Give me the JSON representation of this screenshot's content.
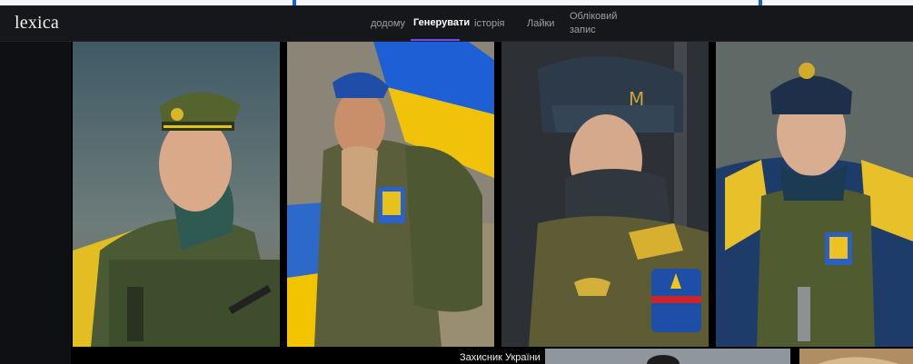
{
  "app": {
    "logo": "lexica"
  },
  "nav": {
    "home": "додому",
    "generate": "Генерувати",
    "history": "історія",
    "likes": "Лайки",
    "account_line1": "Обліковий",
    "account_line2": "запис"
  },
  "gallery": {
    "caption": "Захисник України"
  },
  "colors": {
    "accent": "#6d4cf0",
    "flag_blue": "#1f5fd6",
    "flag_yellow": "#f2c500",
    "uniform": "#556338"
  }
}
